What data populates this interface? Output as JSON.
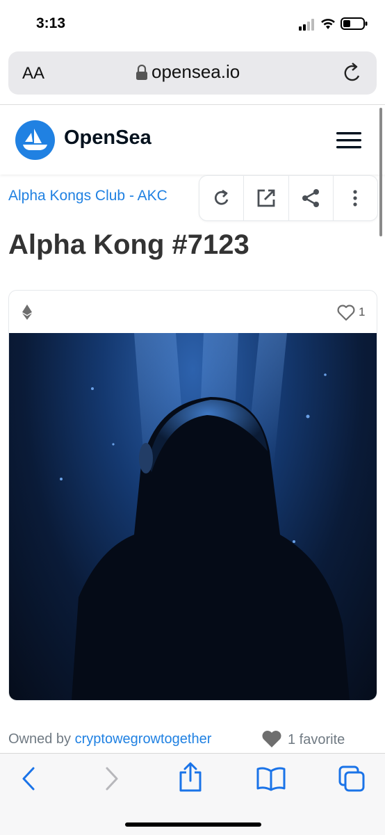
{
  "status_bar": {
    "time": "3:13"
  },
  "browser": {
    "text_size": "AA",
    "url": "opensea.io"
  },
  "header": {
    "brand": "OpenSea"
  },
  "asset": {
    "collection": "Alpha Kongs Club - AKC",
    "title": "Alpha Kong #7123",
    "like_count": "1",
    "owned_by_label": "Owned by",
    "owner": "cryptowegrowtogether",
    "favorites": "1 favorite"
  },
  "colors": {
    "accent": "#2081e2",
    "safari_blue": "#1a73e8"
  },
  "icons": [
    "lock-icon",
    "reload-icon",
    "opensea-logo",
    "menu-icon",
    "refresh-icon",
    "external-link-icon",
    "share-icon",
    "more-icon",
    "ethereum-icon",
    "heart-icon",
    "back-icon",
    "forward-icon",
    "share-sheet-icon",
    "bookmarks-icon",
    "tabs-icon"
  ]
}
